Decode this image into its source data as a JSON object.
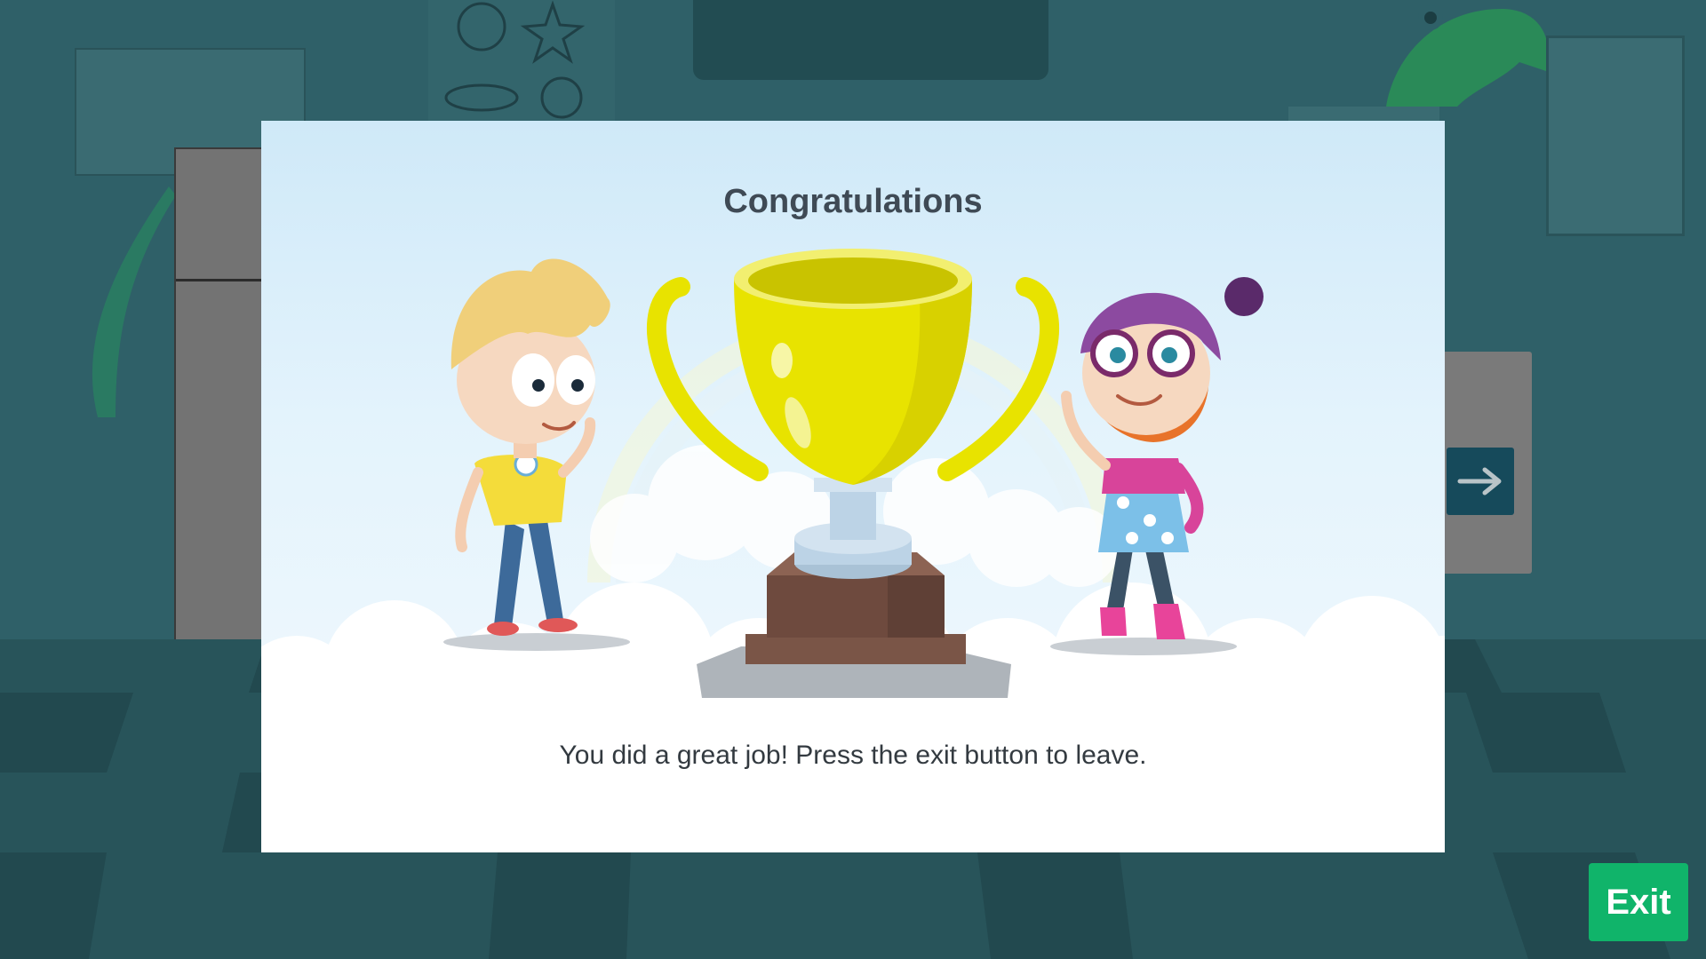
{
  "modal": {
    "title": "Congratulations",
    "message": "You did a great job! Press the exit button to leave."
  },
  "controls": {
    "exit_label": "Exit",
    "next_icon": "arrow-right-icon"
  },
  "colors": {
    "exit_button": "#10b46a",
    "trophy": "#e8e300",
    "background_teal": "#2f6068"
  }
}
